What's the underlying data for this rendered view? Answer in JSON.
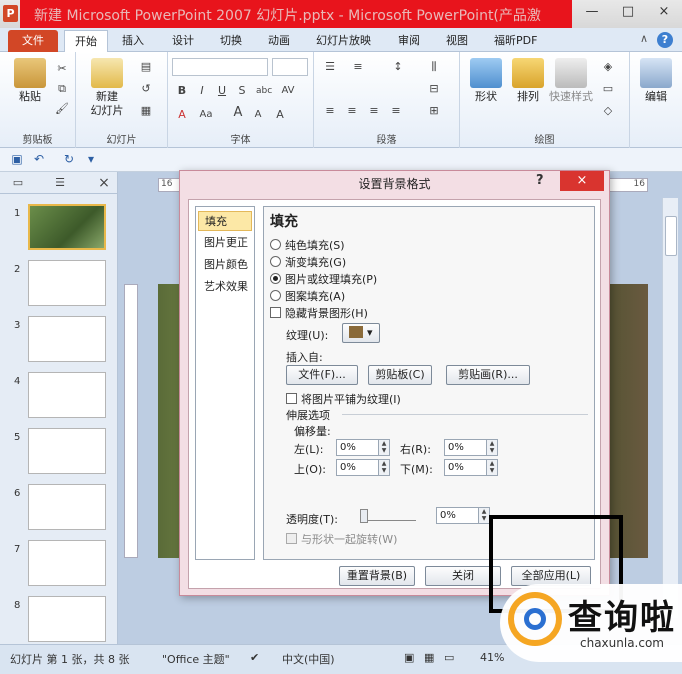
{
  "titlebar": {
    "app_icon_letter": "P",
    "title": "新建 Microsoft PowerPoint 2007 幻灯片.pptx - Microsoft PowerPoint(产品激",
    "minimize": "—",
    "maximize": "□",
    "close": "×"
  },
  "tabs": {
    "file": "文件",
    "items": [
      "开始",
      "插入",
      "设计",
      "切换",
      "动画",
      "幻灯片放映",
      "审阅",
      "视图",
      "福昕PDF"
    ],
    "help": "?",
    "minimize_ribbon": "∧"
  },
  "ribbon": {
    "clipboard": {
      "label": "剪贴板",
      "paste": "粘贴"
    },
    "slides": {
      "label": "幻灯片",
      "new_slide": "新建",
      "new_slide_2": "幻灯片"
    },
    "font": {
      "label": "字体",
      "bold": "B",
      "italic": "I",
      "underline": "U",
      "strike": "S",
      "shadow": "abc",
      "spacing": "AV",
      "aa": "Aa",
      "grow": "A",
      "shrink": "A",
      "clear": "A"
    },
    "paragraph": {
      "label": "段落"
    },
    "drawing": {
      "label": "绘图",
      "shape": "形状",
      "arrange": "排列",
      "quick_style": "快速样式"
    },
    "editing": {
      "label": "编辑",
      "edit": "编辑"
    }
  },
  "slide_panel": {
    "slides": [
      "1",
      "2",
      "3",
      "4",
      "5",
      "6",
      "7",
      "8"
    ]
  },
  "ruler": {
    "h_left": "16",
    "h_right": "16"
  },
  "dialog": {
    "title": "设置背景格式",
    "help": "?",
    "close": "×",
    "nav": [
      "填充",
      "图片更正",
      "图片颜色",
      "艺术效果"
    ],
    "heading": "填充",
    "fill_options": [
      "纯色填充(S)",
      "渐变填充(G)",
      "图片或纹理填充(P)",
      "图案填充(A)"
    ],
    "hide_bg": "隐藏背景图形(H)",
    "texture_label": "纹理(U):",
    "insert_from": "插入自:",
    "btn_file": "文件(F)...",
    "btn_clipboard": "剪贴板(C)",
    "btn_clipart": "剪贴画(R)...",
    "tile": "将图片平铺为纹理(I)",
    "stretch": "伸展选项",
    "offset": "偏移量:",
    "left_label": "左(L):",
    "right_label": "右(R):",
    "top_label": "上(O):",
    "bottom_label": "下(M):",
    "left_val": "0%",
    "right_val": "0%",
    "top_val": "0%",
    "bottom_val": "0%",
    "transparency_label": "透明度(T):",
    "transparency_val": "0%",
    "rotate_with_shape": "与形状一起旋转(W)",
    "btn_reset": "重置背景(B)",
    "btn_close": "关闭",
    "btn_apply_all": "全部应用(L)"
  },
  "statusbar": {
    "slide_info": "幻灯片 第 1 张，共 8 张",
    "theme": "\"Office 主题\"",
    "language": "中文(中国)",
    "zoom": "41%"
  },
  "watermark": {
    "text": "查询啦",
    "sub": "chaxunla.com"
  }
}
